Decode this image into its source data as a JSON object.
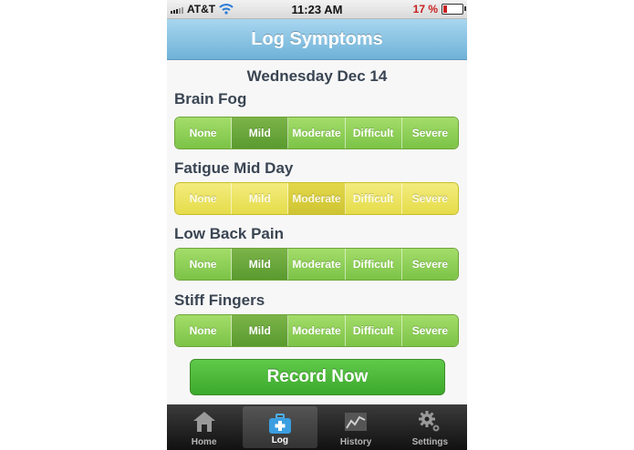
{
  "status_bar": {
    "carrier": "AT&T",
    "time": "11:23 AM",
    "battery": "17 %",
    "battery_level": 0.17
  },
  "nav": {
    "title": "Log Symptoms"
  },
  "date": "Wednesday Dec 14",
  "severity_options": [
    "None",
    "Mild",
    "Moderate",
    "Difficult",
    "Severe"
  ],
  "symptoms": [
    {
      "name": "Brain Fog",
      "selected": "Mild",
      "color": "green"
    },
    {
      "name": "Fatigue Mid Day",
      "selected": "Moderate",
      "color": "yellow"
    },
    {
      "name": "Low Back Pain",
      "selected": "Mild",
      "color": "green"
    },
    {
      "name": "Stiff Fingers",
      "selected": "Mild",
      "color": "green"
    }
  ],
  "record_button": "Record Now",
  "tabs": [
    {
      "label": "Home",
      "icon": "home-icon",
      "active": false
    },
    {
      "label": "Log",
      "icon": "medical-kit-icon",
      "active": true
    },
    {
      "label": "History",
      "icon": "chart-icon",
      "active": false
    },
    {
      "label": "Settings",
      "icon": "gear-icon",
      "active": false
    }
  ],
  "colors": {
    "nav_bar": "#6fb2d8",
    "green_button": "#7cc347",
    "green_selected": "#5a9a2f",
    "yellow_button": "#e5dc4a",
    "record_button": "#3ca92c",
    "battery_text": "#c81f1f"
  }
}
